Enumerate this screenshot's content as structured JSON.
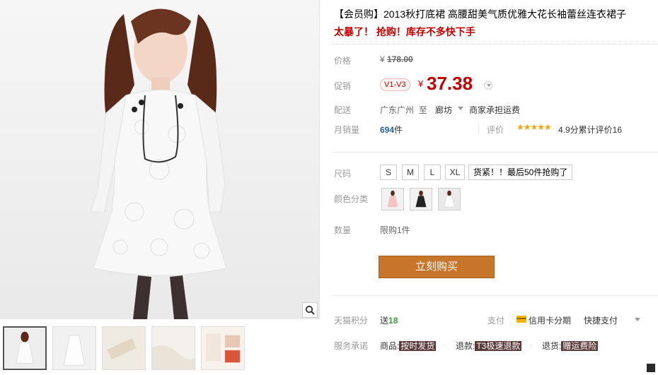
{
  "gallery": {
    "zoom_icon": "magnifier-icon",
    "thumbs_count_note": ""
  },
  "product": {
    "title": "【会员购】2013秋打底裙 高腰甜美气质优雅大花长袖蕾丝连衣裙子",
    "promo": "太暴了！ 抢购！库存不多快下手"
  },
  "price": {
    "label": "价格",
    "currency": "¥",
    "original": "178.00",
    "promo_label": "促销",
    "member_tag": "V1-V3",
    "current": "37.38"
  },
  "shipping": {
    "label": "配送",
    "from": "广东广州",
    "to_word": "至",
    "to": "廊坊",
    "fee": "商家承担运费"
  },
  "sales": {
    "label": "月销量",
    "count": "694",
    "unit": "件",
    "rating_label": "评价",
    "stars": "★★★★★",
    "rating_text": "4.9分累计评价16"
  },
  "sku": {
    "size_label": "尺码",
    "sizes": [
      "S",
      "M",
      "L",
      "XL"
    ],
    "stock_tip": "货紧！！最后50件抢购了",
    "color_label": "颜色分类",
    "qty_label": "数量",
    "qty_limit": "限购1件",
    "buy_label": "立刻购买"
  },
  "services": {
    "points_label": "天猫积分",
    "points_prefix": "送",
    "points_value": "18",
    "pay_label": "支付",
    "pay_card": "信用卡分期",
    "pay_fast": "快捷支付",
    "promise_label": "服务承诺",
    "goods_prefix": "商品:",
    "goods_tag": "按时发货",
    "refund_prefix": "退款:",
    "refund_tag": "T3极速退款",
    "return_prefix": "退货:",
    "return_tag": "赠运费险"
  },
  "colors": {
    "price_red": "#c40000",
    "buy_button": "#c8752c",
    "sales_blue": "#2b5ea1",
    "star_gold": "#f7a400",
    "points_green": "#39a03c"
  }
}
